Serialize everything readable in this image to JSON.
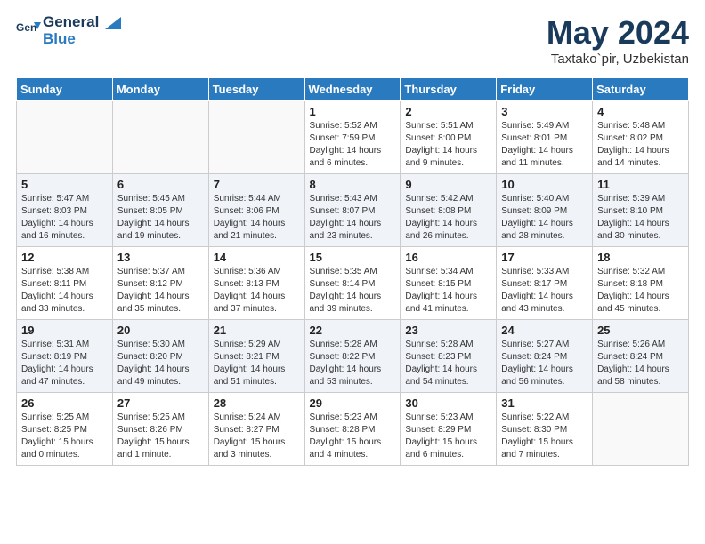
{
  "header": {
    "logo_line1": "General",
    "logo_line2": "Blue",
    "month": "May 2024",
    "location": "Taxtako`pir, Uzbekistan"
  },
  "days_of_week": [
    "Sunday",
    "Monday",
    "Tuesday",
    "Wednesday",
    "Thursday",
    "Friday",
    "Saturday"
  ],
  "weeks": [
    [
      {
        "day": "",
        "detail": ""
      },
      {
        "day": "",
        "detail": ""
      },
      {
        "day": "",
        "detail": ""
      },
      {
        "day": "1",
        "detail": "Sunrise: 5:52 AM\nSunset: 7:59 PM\nDaylight: 14 hours\nand 6 minutes."
      },
      {
        "day": "2",
        "detail": "Sunrise: 5:51 AM\nSunset: 8:00 PM\nDaylight: 14 hours\nand 9 minutes."
      },
      {
        "day": "3",
        "detail": "Sunrise: 5:49 AM\nSunset: 8:01 PM\nDaylight: 14 hours\nand 11 minutes."
      },
      {
        "day": "4",
        "detail": "Sunrise: 5:48 AM\nSunset: 8:02 PM\nDaylight: 14 hours\nand 14 minutes."
      }
    ],
    [
      {
        "day": "5",
        "detail": "Sunrise: 5:47 AM\nSunset: 8:03 PM\nDaylight: 14 hours\nand 16 minutes."
      },
      {
        "day": "6",
        "detail": "Sunrise: 5:45 AM\nSunset: 8:05 PM\nDaylight: 14 hours\nand 19 minutes."
      },
      {
        "day": "7",
        "detail": "Sunrise: 5:44 AM\nSunset: 8:06 PM\nDaylight: 14 hours\nand 21 minutes."
      },
      {
        "day": "8",
        "detail": "Sunrise: 5:43 AM\nSunset: 8:07 PM\nDaylight: 14 hours\nand 23 minutes."
      },
      {
        "day": "9",
        "detail": "Sunrise: 5:42 AM\nSunset: 8:08 PM\nDaylight: 14 hours\nand 26 minutes."
      },
      {
        "day": "10",
        "detail": "Sunrise: 5:40 AM\nSunset: 8:09 PM\nDaylight: 14 hours\nand 28 minutes."
      },
      {
        "day": "11",
        "detail": "Sunrise: 5:39 AM\nSunset: 8:10 PM\nDaylight: 14 hours\nand 30 minutes."
      }
    ],
    [
      {
        "day": "12",
        "detail": "Sunrise: 5:38 AM\nSunset: 8:11 PM\nDaylight: 14 hours\nand 33 minutes."
      },
      {
        "day": "13",
        "detail": "Sunrise: 5:37 AM\nSunset: 8:12 PM\nDaylight: 14 hours\nand 35 minutes."
      },
      {
        "day": "14",
        "detail": "Sunrise: 5:36 AM\nSunset: 8:13 PM\nDaylight: 14 hours\nand 37 minutes."
      },
      {
        "day": "15",
        "detail": "Sunrise: 5:35 AM\nSunset: 8:14 PM\nDaylight: 14 hours\nand 39 minutes."
      },
      {
        "day": "16",
        "detail": "Sunrise: 5:34 AM\nSunset: 8:15 PM\nDaylight: 14 hours\nand 41 minutes."
      },
      {
        "day": "17",
        "detail": "Sunrise: 5:33 AM\nSunset: 8:17 PM\nDaylight: 14 hours\nand 43 minutes."
      },
      {
        "day": "18",
        "detail": "Sunrise: 5:32 AM\nSunset: 8:18 PM\nDaylight: 14 hours\nand 45 minutes."
      }
    ],
    [
      {
        "day": "19",
        "detail": "Sunrise: 5:31 AM\nSunset: 8:19 PM\nDaylight: 14 hours\nand 47 minutes."
      },
      {
        "day": "20",
        "detail": "Sunrise: 5:30 AM\nSunset: 8:20 PM\nDaylight: 14 hours\nand 49 minutes."
      },
      {
        "day": "21",
        "detail": "Sunrise: 5:29 AM\nSunset: 8:21 PM\nDaylight: 14 hours\nand 51 minutes."
      },
      {
        "day": "22",
        "detail": "Sunrise: 5:28 AM\nSunset: 8:22 PM\nDaylight: 14 hours\nand 53 minutes."
      },
      {
        "day": "23",
        "detail": "Sunrise: 5:28 AM\nSunset: 8:23 PM\nDaylight: 14 hours\nand 54 minutes."
      },
      {
        "day": "24",
        "detail": "Sunrise: 5:27 AM\nSunset: 8:24 PM\nDaylight: 14 hours\nand 56 minutes."
      },
      {
        "day": "25",
        "detail": "Sunrise: 5:26 AM\nSunset: 8:24 PM\nDaylight: 14 hours\nand 58 minutes."
      }
    ],
    [
      {
        "day": "26",
        "detail": "Sunrise: 5:25 AM\nSunset: 8:25 PM\nDaylight: 15 hours\nand 0 minutes."
      },
      {
        "day": "27",
        "detail": "Sunrise: 5:25 AM\nSunset: 8:26 PM\nDaylight: 15 hours\nand 1 minute."
      },
      {
        "day": "28",
        "detail": "Sunrise: 5:24 AM\nSunset: 8:27 PM\nDaylight: 15 hours\nand 3 minutes."
      },
      {
        "day": "29",
        "detail": "Sunrise: 5:23 AM\nSunset: 8:28 PM\nDaylight: 15 hours\nand 4 minutes."
      },
      {
        "day": "30",
        "detail": "Sunrise: 5:23 AM\nSunset: 8:29 PM\nDaylight: 15 hours\nand 6 minutes."
      },
      {
        "day": "31",
        "detail": "Sunrise: 5:22 AM\nSunset: 8:30 PM\nDaylight: 15 hours\nand 7 minutes."
      },
      {
        "day": "",
        "detail": ""
      }
    ]
  ]
}
